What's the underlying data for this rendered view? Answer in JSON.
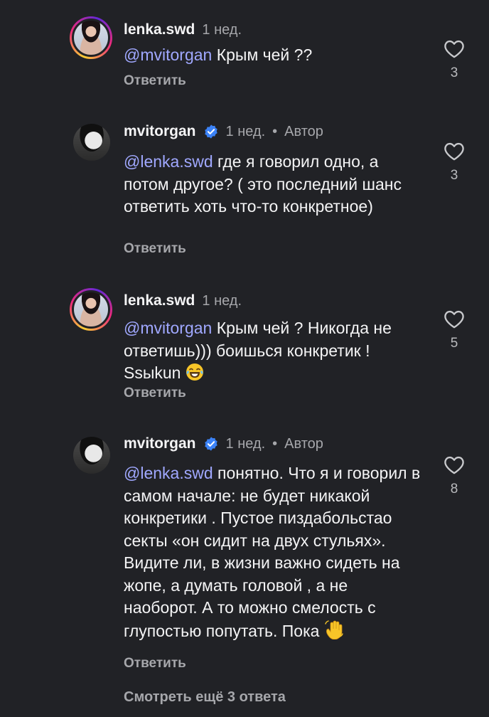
{
  "comments": [
    {
      "username": "lenka.swd",
      "time": "1 нед.",
      "mention": "@mvitorgan",
      "text": " Крым чей ??",
      "reply": "Ответить",
      "likes": "3"
    },
    {
      "username": "mvitorgan",
      "time": "1 нед.",
      "dot": "•",
      "author": "Автор",
      "mention": "@lenka.swd",
      "text": " где я говорил одно, а потом другое? ( это последний шанс ответить хоть что-то конкретное)",
      "reply": "Ответить",
      "likes": "3"
    },
    {
      "username": "lenka.swd",
      "time": "1 нед.",
      "mention": "@mvitorgan",
      "text": " Крым чей ? Никогда не ответишь))) боишься конкретик ! Ssыkun",
      "reply": "Ответить",
      "likes": "5"
    },
    {
      "username": "mvitorgan",
      "time": "1 нед.",
      "dot": "•",
      "author": "Автор",
      "mention": "@lenka.swd",
      "text": " понятно. Что я и говорил в самом начале: не будет никакой конкретики . Пустое пиздабольстао секты «он сидит на двух стульях». Видите ли, в жизни важно сидеть на жопе, а думать головой , а не наоборот. А то можно смелость с глупостью попутать. Пока",
      "reply": "Ответить",
      "likes": "8"
    }
  ],
  "view_more": "Смотреть ещё 3 ответа",
  "icons": {
    "heart": "heart-icon",
    "verified": "verified-badge-icon",
    "laughing": "laughing-emoji",
    "wave": "waving-hand-emoji"
  },
  "colors": {
    "background": "#212226",
    "mention": "#a0a8ff",
    "verified": "#3b82f6",
    "secondary_text": "#a6a7ab"
  }
}
